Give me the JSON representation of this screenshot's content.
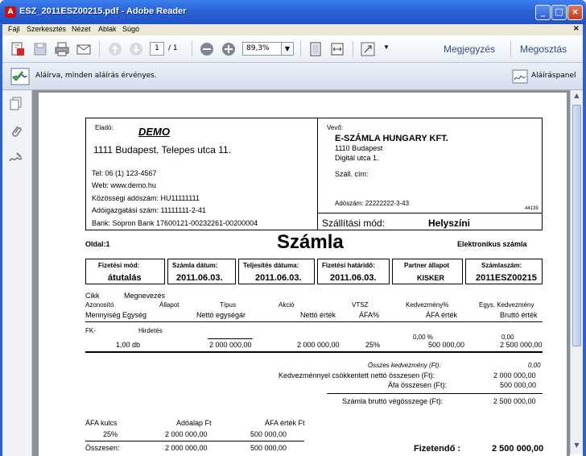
{
  "window": {
    "title": "ESZ_2011ESZ00215.pdf - Adobe Reader",
    "min": "_",
    "max": "□",
    "close": "×"
  },
  "menu": {
    "items": [
      "Fájl",
      "Szerkesztés",
      "Nézet",
      "Ablak",
      "Súgó"
    ],
    "close": "×"
  },
  "toolbar": {
    "page_current": "1",
    "page_total": "/ 1",
    "zoom": "89,3%",
    "comment": "Megjegyzés",
    "share": "Megosztás"
  },
  "signature": {
    "message": "Aláírva, minden aláírás érvényes.",
    "panel": "Aláíráspanel"
  },
  "invoice": {
    "seller_label": "Eladó:",
    "seller_name": "DEMO",
    "seller_address": "1111 Budapest, Telepes utca 11.",
    "seller_tel": "Tel: 06 (1) 123-4567",
    "seller_web": "Web: www.demo.hu",
    "seller_eu_tax": "Közösségi adószám: HU11111111",
    "seller_tax": "Adóigazgatási szám: 11111111-2-41",
    "seller_bank": "Bank:  Sopron Bank  17600121-00232261-00200004",
    "buyer_label": "Vevő:",
    "buyer_name": "E-SZÁMLA HUNGARY KFT.",
    "buyer_city": "1110 Budapest",
    "buyer_street": "Digitál utca 1.",
    "buyer_ship_addr": "Száll. cím:",
    "buyer_tax": "Adószám:   22222222-3-43",
    "buyer_code": "44139",
    "ship_mode_label": "Szállítási mód:",
    "ship_mode": "Helyszíni",
    "page": "Oldal:1",
    "title": "Számla",
    "doc_type": "Elektronikus számla",
    "hdr": {
      "labels": [
        "Fizetési mód:",
        "Számla dátum:",
        "Teljesítés dátuma:",
        "Fizetési határidő:",
        "Partner állapot",
        "Számlaszám:"
      ],
      "values": [
        "átutalás",
        "2011.06.03.",
        "2011.06.03.",
        "2011.06.03.",
        "KISKER",
        "2011ESZ00215"
      ]
    },
    "cols": {
      "r1a": "Cikk",
      "r1b": "Megnevezés",
      "r2": [
        "Azonosító",
        "Állapot",
        "Típus",
        "Akció",
        "VTSZ",
        "Kedvezmény%",
        "Egys. Kedvezmény"
      ],
      "r3": [
        "Mennyiség Egység",
        "Nettó egységár",
        "Nettó érték",
        "ÁFA%",
        "ÁFA érték",
        "Bruttó érték"
      ]
    },
    "item": {
      "code": "FK-",
      "name": "Hirdetés",
      "qty": "1,00 db",
      "unit_price": "2 000 000,00",
      "net": "2 000 000,00",
      "vat_pct": "25%",
      "disc_pct": "0,00 %",
      "vat_val": "500 000,00",
      "unit_disc": "0,00",
      "gross": "2 500 000,00"
    },
    "totals": {
      "discount_label": "Összes kedvezmény (Ft):",
      "discount": "0,00",
      "net_label": "Kedvezménnyel csökkentett nettó összesen (Ft):",
      "net": "2 000 000,00",
      "vat_label": "Áfa összesen (Ft):",
      "vat": "500 000,00",
      "gross_label": "Számla bruttó végösszege (Ft):",
      "gross": "2 500 000,00"
    },
    "vat_table": {
      "headers": [
        "ÁFA kulcs",
        "Adóalap Ft",
        "ÁFA érték Ft"
      ],
      "row": [
        "25%",
        "2 000 000,00",
        "500 000,00"
      ],
      "sum_label": "Összesen:",
      "sum_base": "2 000 000,00",
      "sum_vat": "500 000,00"
    },
    "payable_label": "Fizetendő :",
    "payable": "2 500 000,00"
  }
}
